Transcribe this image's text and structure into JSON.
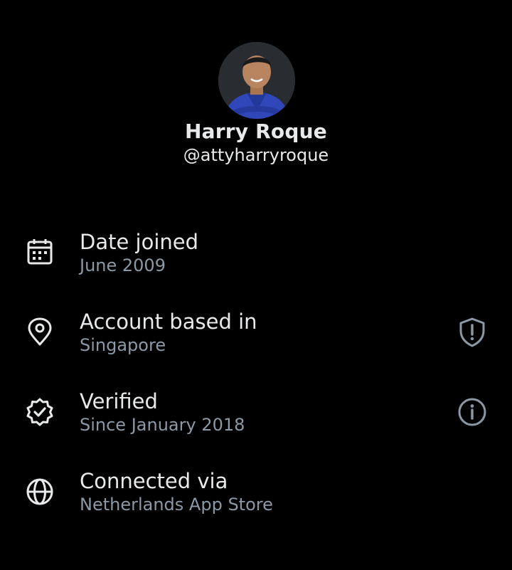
{
  "profile": {
    "display_name": "Harry Roque",
    "handle": "@attyharryroque",
    "avatar_icon": "profile-photo"
  },
  "rows": [
    {
      "title": "Date joined",
      "subtitle": "June 2009",
      "icon": "calendar-icon"
    },
    {
      "title": "Account based in",
      "subtitle": "Singapore",
      "icon": "location-pin-icon",
      "trailing_icon": "shield-alert-icon"
    },
    {
      "title": "Verified",
      "subtitle": "Since January 2018",
      "icon": "verified-badge-icon",
      "trailing_icon": "info-icon"
    },
    {
      "title": "Connected via",
      "subtitle": "Netherlands App Store",
      "icon": "globe-icon"
    }
  ],
  "colors": {
    "background": "#000000",
    "primary_text": "#e7e9ea",
    "secondary_text": "#8b98a5",
    "icon": "#e7e9ea",
    "trailing_icon": "#8b98a5"
  }
}
